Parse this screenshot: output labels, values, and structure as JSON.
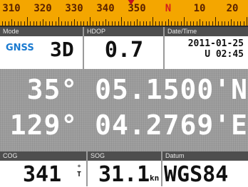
{
  "compass": {
    "labels": [
      "310",
      "320",
      "330",
      "340",
      "350",
      "N",
      "10",
      "20"
    ],
    "north_color": "#d41e1e"
  },
  "top": {
    "mode_label": "Mode",
    "hdop_label": "HDOP",
    "datetime_label": "Date/Time",
    "gnss": "GNSS",
    "fix": "3D",
    "hdop": "0.7",
    "date": "2011-01-25",
    "time": "U 02:45"
  },
  "position": {
    "lat": "35° 05.1500'N",
    "lon": "129° 04.2769'E"
  },
  "bottom": {
    "cog_label": "COG",
    "sog_label": "SOG",
    "datum_label": "Datum",
    "cog": "341",
    "cog_unit_top": "°",
    "cog_unit_bottom": "T",
    "sog": "31.1",
    "sog_unit": "kn",
    "datum": "WGS84"
  }
}
